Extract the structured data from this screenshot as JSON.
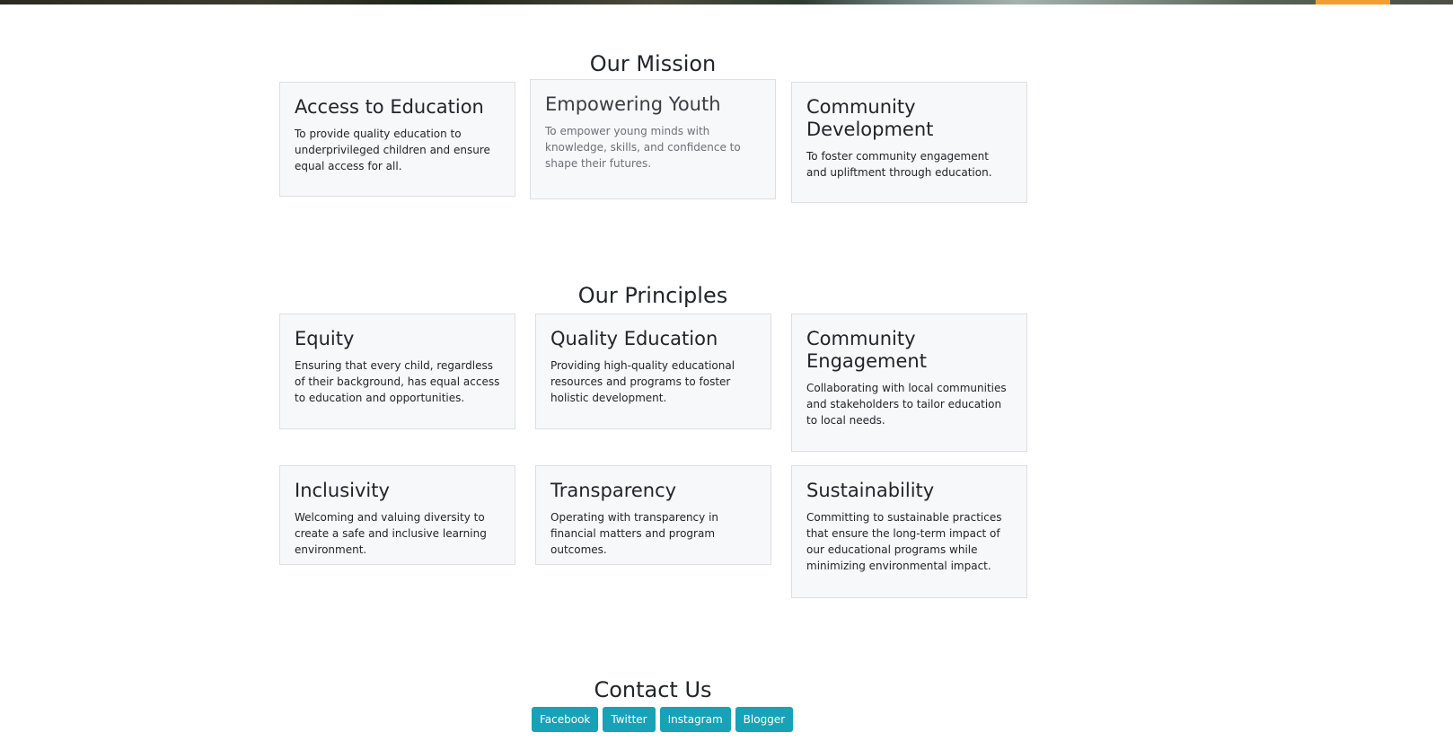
{
  "mission": {
    "title": "Our Mission",
    "cards": [
      {
        "title": "Access to Education",
        "text": "To provide quality education to underprivileged children and ensure equal access for all."
      },
      {
        "title": "Empowering Youth",
        "text": "To empower young minds with knowledge, skills, and confidence to shape their futures."
      },
      {
        "title": "Community Development",
        "text": "To foster community engagement and upliftment through education."
      }
    ]
  },
  "principles": {
    "title": "Our Principles",
    "cards": [
      {
        "title": "Equity",
        "text": "Ensuring that every child, regardless of their background, has equal access to education and opportunities."
      },
      {
        "title": "Quality Education",
        "text": "Providing high-quality educational resources and programs to foster holistic development."
      },
      {
        "title": "Community Engagement",
        "text": "Collaborating with local communities and stakeholders to tailor education to local needs."
      },
      {
        "title": "Inclusivity",
        "text": "Welcoming and valuing diversity to create a safe and inclusive learning environment."
      },
      {
        "title": "Transparency",
        "text": "Operating with transparency in financial matters and program outcomes."
      },
      {
        "title": "Sustainability",
        "text": "Committing to sustainable practices that ensure the long-term impact of our educational programs while minimizing environmental impact."
      }
    ]
  },
  "contact": {
    "title": "Contact Us",
    "buttons": [
      "Facebook",
      "Twitter",
      "Instagram",
      "Blogger"
    ]
  },
  "colors": {
    "button_bg": "#17a2b8",
    "card_bg": "#f7f8fa",
    "hero_accent": "#f0a030"
  }
}
